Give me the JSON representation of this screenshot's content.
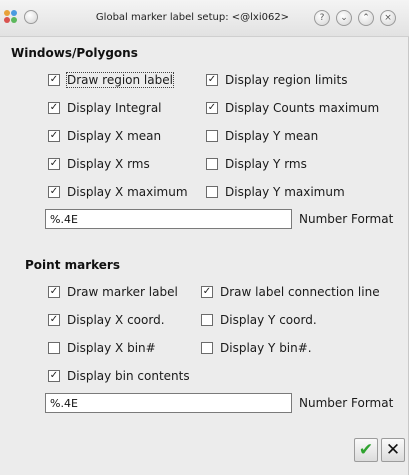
{
  "window": {
    "title": "Global marker label setup: <@lxi062>",
    "help_glyph": "?",
    "minimize_glyph": "⌄",
    "maximize_glyph": "⌃",
    "close_glyph": "×"
  },
  "windows_polygons": {
    "title": "Windows/Polygons",
    "options": [
      {
        "label": "Draw region label",
        "checked": true
      },
      {
        "label": "Display region limits",
        "checked": true
      },
      {
        "label": "Display Integral",
        "checked": true
      },
      {
        "label": "Display Counts maximum",
        "checked": true
      },
      {
        "label": "Display X mean",
        "checked": true
      },
      {
        "label": "Display Y mean",
        "checked": false
      },
      {
        "label": "Display X rms",
        "checked": true
      },
      {
        "label": "Display Y rms",
        "checked": false
      },
      {
        "label": "Display X maximum",
        "checked": true
      },
      {
        "label": "Display Y maximum",
        "checked": false
      }
    ],
    "format_value": "%.4E",
    "format_label": "Number Format"
  },
  "point_markers": {
    "title": "Point markers",
    "options": [
      {
        "label": "Draw marker label",
        "checked": true
      },
      {
        "label": "Draw label connection line",
        "checked": true
      },
      {
        "label": "Display X coord.",
        "checked": true
      },
      {
        "label": "Display Y coord.",
        "checked": false
      },
      {
        "label": "Display X bin#",
        "checked": false
      },
      {
        "label": "Display Y bin#.",
        "checked": false
      },
      {
        "label": "Display bin contents",
        "checked": true
      }
    ],
    "format_value": "%.4E",
    "format_label": "Number Format"
  },
  "buttons": {
    "ok_glyph": "✔",
    "cancel_glyph": "✕"
  },
  "check_glyph": "✓",
  "colors": {
    "ok_green": "#2fa32f",
    "cancel_black": "#111111"
  }
}
